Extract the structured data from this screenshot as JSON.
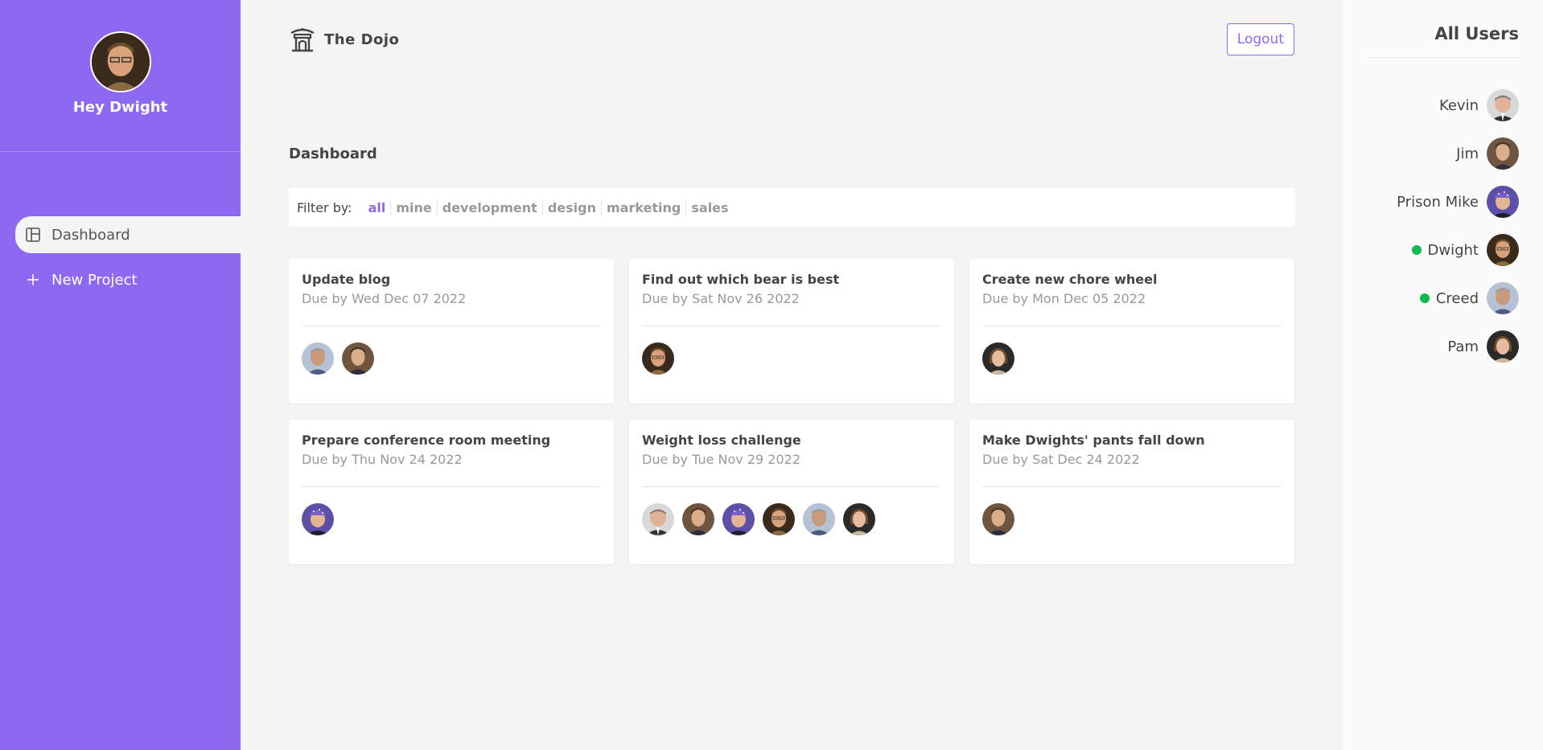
{
  "sidebar": {
    "greeting": "Hey Dwight",
    "nav": [
      {
        "label": "Dashboard",
        "icon": "dashboard-icon",
        "active": true
      },
      {
        "label": "New Project",
        "icon": "plus-icon",
        "active": false
      }
    ]
  },
  "navbar": {
    "brand": "The Dojo",
    "logout_label": "Logout"
  },
  "dashboard": {
    "title": "Dashboard",
    "filter_label": "Filter by:",
    "filters": [
      "all",
      "mine",
      "development",
      "design",
      "marketing",
      "sales"
    ],
    "active_filter": "all"
  },
  "projects": [
    {
      "title": "Update blog",
      "due": "Due by Wed Dec 07 2022"
    },
    {
      "title": "Find out which bear is best",
      "due": "Due by Sat Nov 26 2022"
    },
    {
      "title": "Create new chore wheel",
      "due": "Due by Mon Dec 05 2022"
    },
    {
      "title": "Prepare conference room meeting",
      "due": "Due by Thu Nov 24 2022"
    },
    {
      "title": "Weight loss challenge",
      "due": "Due by Tue Nov 29 2022"
    },
    {
      "title": "Make Dwights' pants fall down",
      "due": "Due by Sat Dec 24 2022"
    }
  ],
  "users_panel": {
    "title": "All Users",
    "users": [
      {
        "name": "Kevin",
        "online": false
      },
      {
        "name": "Jim",
        "online": false
      },
      {
        "name": "Prison Mike",
        "online": true
      },
      {
        "name": "Dwight",
        "online": true
      },
      {
        "name": "Creed",
        "online": true
      },
      {
        "name": "Pam",
        "online": false
      }
    ]
  },
  "colors": {
    "primary": "#8d69f1",
    "background": "#f4f4f4",
    "online": "#0ebb50"
  }
}
